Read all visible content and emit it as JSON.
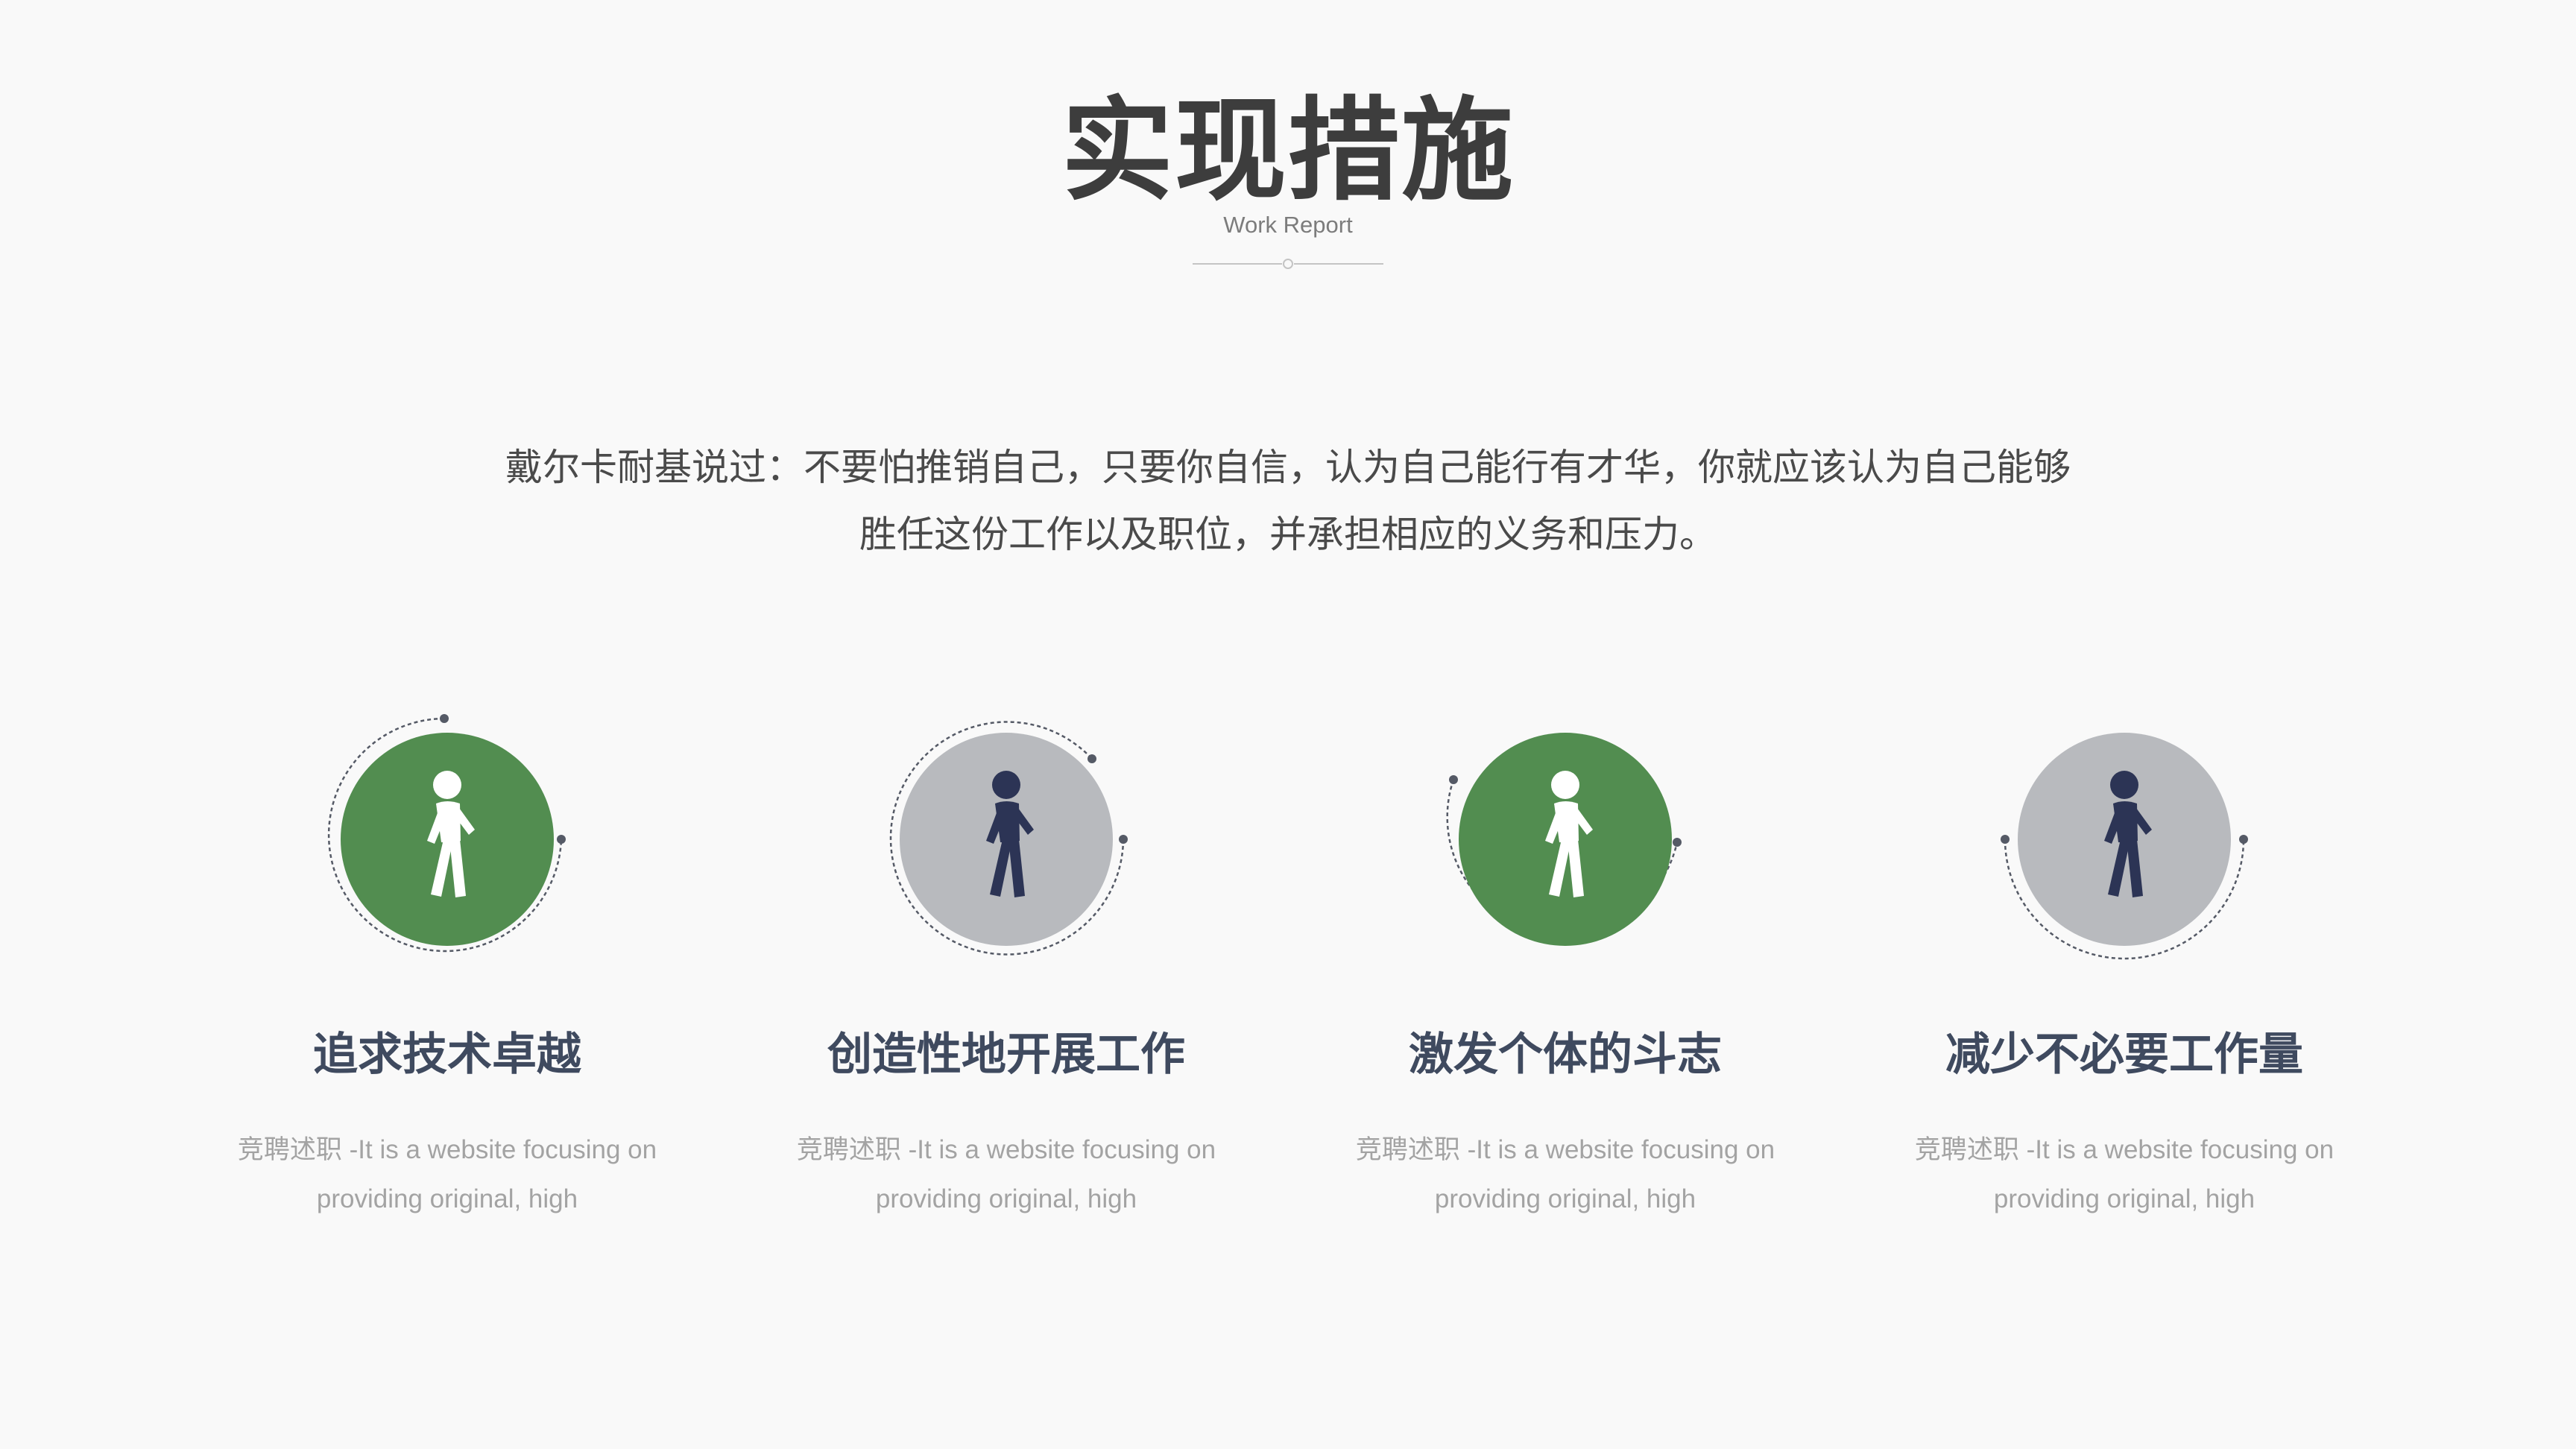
{
  "header": {
    "title": "实现措施",
    "subtitle": "Work Report"
  },
  "quote": {
    "line1": "戴尔卡耐基说过：不要怕推销自己，只要你自信，认为自己能行有才华，你就应该认为自己能够",
    "line2": "胜任这份工作以及职位，并承担相应的义务和压力。"
  },
  "colors": {
    "green": "#528d50",
    "gray": "#b8babe",
    "navy": "#2c3455",
    "white": "#ffffff",
    "title": "#3d3d3d",
    "card_title": "#3f4a5f",
    "desc": "#a3a3a3"
  },
  "cards": [
    {
      "title": "追求技术卓越",
      "desc_line1": "竞聘述职 -It is a website focusing on",
      "desc_line2": "providing original, high",
      "icon": "walking-person-icon",
      "circle_color": "green",
      "figure_color": "white"
    },
    {
      "title": "创造性地开展工作",
      "desc_line1": "竞聘述职 -It is a website focusing on",
      "desc_line2": "providing original, high",
      "icon": "walking-person-icon",
      "circle_color": "gray",
      "figure_color": "navy"
    },
    {
      "title": "激发个体的斗志",
      "desc_line1": "竞聘述职 -It is a website focusing on",
      "desc_line2": "providing original, high",
      "icon": "walking-person-icon",
      "circle_color": "green",
      "figure_color": "white"
    },
    {
      "title": "减少不必要工作量",
      "desc_line1": "竞聘述职 -It is a website focusing on",
      "desc_line2": "providing original, high",
      "icon": "walking-person-icon",
      "circle_color": "gray",
      "figure_color": "navy"
    }
  ]
}
